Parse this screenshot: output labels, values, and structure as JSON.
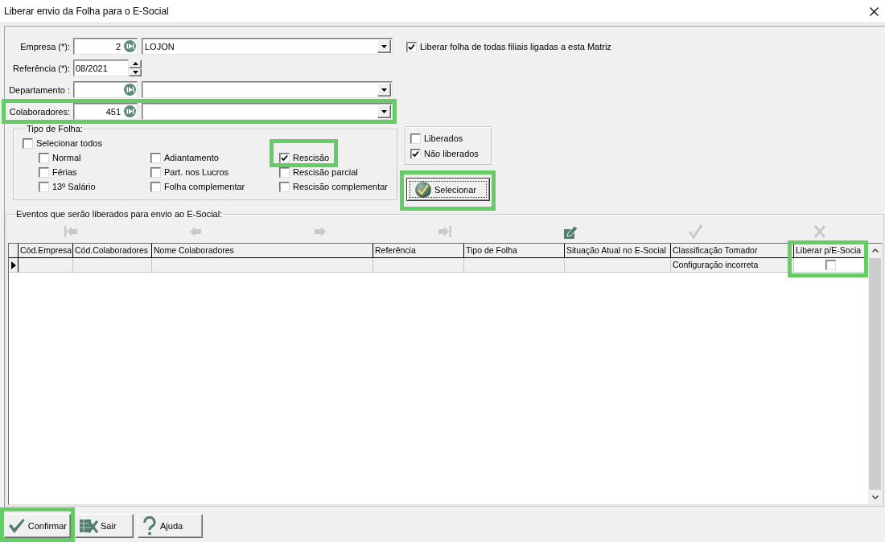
{
  "window": {
    "title": "Liberar envio da Folha para o E-Social"
  },
  "form": {
    "fields": [
      {
        "label": "Empresa (*):",
        "kind": "lookup",
        "code": "2",
        "name": "LOJON",
        "highlighted": false
      },
      {
        "label": "Referência (*):",
        "kind": "spin",
        "value": "08/2021",
        "highlighted": false
      },
      {
        "label": "Departamento :",
        "kind": "lookup",
        "highlighted": false
      },
      {
        "label": "Colaboradores:",
        "kind": "lookup",
        "code": "451",
        "highlighted": true
      }
    ],
    "matriz_option": {
      "label": "Liberar folha de todas filiais ligadas a esta Matriz",
      "checked": true
    },
    "tipo_de_folha": {
      "title": "Tipo de Folha:",
      "select_all": {
        "label": "Selecionar todos",
        "checked": false
      },
      "columns": [
        {
          "options": [
            {
              "label": "Normal",
              "checked": false,
              "highlighted": false
            },
            {
              "label": "Férias",
              "checked": false,
              "highlighted": false
            },
            {
              "label": "13º Salário",
              "checked": false,
              "highlighted": false
            }
          ]
        },
        {
          "options": [
            {
              "label": "Adiantamento",
              "checked": false,
              "highlighted": false
            },
            {
              "label": "Part. nos Lucros",
              "checked": false,
              "highlighted": false
            },
            {
              "label": "Folha complementar",
              "checked": false,
              "highlighted": false
            }
          ]
        },
        {
          "options": [
            {
              "label": "Rescisão",
              "checked": true,
              "highlighted": true
            },
            {
              "label": "Rescisão parcial",
              "checked": false,
              "highlighted": false
            },
            {
              "label": "Rescisão complementar",
              "checked": false,
              "highlighted": false
            }
          ]
        }
      ]
    },
    "status_filter": [
      {
        "label": "Liberados",
        "checked": false
      },
      {
        "label": "Não liberados",
        "checked": true
      }
    ],
    "select_button": {
      "label": "Selecionar",
      "highlighted": true
    }
  },
  "events": {
    "title": "Eventos que serão liberados para envio ao E-Social:",
    "navigator": [
      {
        "kind": "first",
        "disabled": true
      },
      {
        "kind": "prior",
        "disabled": true
      },
      {
        "kind": "next",
        "disabled": true
      },
      {
        "kind": "last",
        "disabled": true
      },
      {
        "kind": "edit",
        "disabled": false
      },
      {
        "kind": "post",
        "disabled": true
      },
      {
        "kind": "cancel",
        "disabled": true
      }
    ],
    "table": {
      "columns": [
        {
          "label": "Cód.Empresa",
          "highlighted": false
        },
        {
          "label": "Cód.Colaboradores",
          "highlighted": false
        },
        {
          "label": "Nome Colaboradores",
          "highlighted": false
        },
        {
          "label": "Referência",
          "highlighted": false
        },
        {
          "label": "Tipo de Folha",
          "highlighted": false
        },
        {
          "label": "Situação Atual no E-Social",
          "highlighted": false
        },
        {
          "label": "Classificação Tomador",
          "highlighted": false
        },
        {
          "label": "Liberar p/E-Socia",
          "highlighted": true
        }
      ],
      "rows": [
        {
          "current": true,
          "classificacao_tomador": "Configuração incorreta",
          "liberar": {
            "checked": false
          }
        }
      ]
    }
  },
  "buttons": [
    {
      "label": "Confirmar",
      "kind": "confirm",
      "highlighted": true
    },
    {
      "label": "Sair",
      "kind": "exit",
      "highlighted": false
    },
    {
      "label": "Ajuda",
      "kind": "help",
      "highlighted": false
    }
  ]
}
